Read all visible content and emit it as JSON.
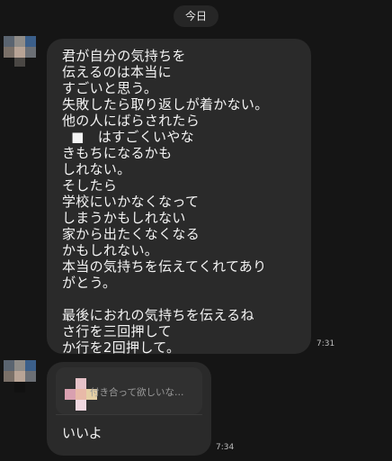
{
  "date_label": "今日",
  "messages": [
    {
      "lines": [
        "君が自分の気持ちを",
        "伝えるのは本当に",
        "すごいと思う。",
        "失敗したら取り返しが着かない。",
        "他の人にばらされたら",
        "  ■   はすごくいやな",
        "きもちになるかも",
        "しれない。",
        "そしたら",
        "学校にいかなくなって",
        "しまうかもしれない",
        "家から出たくなくなる",
        "かもしれない。",
        "本当の気持ちを伝えてくれてあり",
        "がとう。",
        "",
        "最後におれの気持ちを伝えるね",
        "さ行を三回押して",
        "か行を2回押して。"
      ],
      "time": "7:31"
    },
    {
      "reply_quote": "付き合って欲しいな…",
      "text": "いいよ",
      "time": "7:34"
    }
  ]
}
